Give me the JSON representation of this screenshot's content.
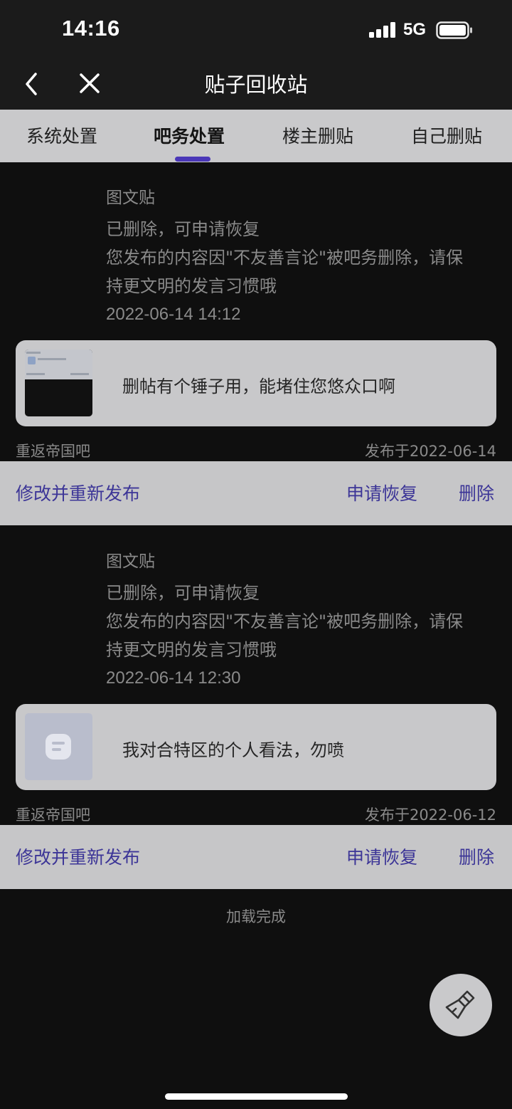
{
  "status_bar": {
    "time": "14:16",
    "network": "5G"
  },
  "header": {
    "title": "贴子回收站",
    "back_icon": "chevron-left-icon",
    "close_icon": "close-icon"
  },
  "tabs": [
    {
      "label": "系统处置",
      "active": false
    },
    {
      "label": "吧务处置",
      "active": true
    },
    {
      "label": "楼主删贴",
      "active": false
    },
    {
      "label": "自己删贴",
      "active": false
    }
  ],
  "accent_color": "#4a37b8",
  "posts": [
    {
      "type": "图文贴",
      "status": "已删除，可申请恢复",
      "reason": "您发布的内容因\"不友善言论\"被吧务删除，请保持更文明的发言习惯哦",
      "time": "2022-06-14 14:12",
      "preview_text": "删帖有个锤子用，能堵住您悠众口啊",
      "thumbnail": "screenshot-thumbnail",
      "forum": "重返帝国吧",
      "published": "发布于2022-06-14",
      "actions": {
        "edit": "修改并重新发布",
        "restore": "申请恢复",
        "delete": "删除"
      }
    },
    {
      "type": "图文贴",
      "status": "已删除，可申请恢复",
      "reason": "您发布的内容因\"不友善言论\"被吧务删除，请保持更文明的发言习惯哦",
      "time": "2022-06-14 12:30",
      "preview_text": "我对合特区的个人看法，勿喷",
      "thumbnail": "document-icon",
      "forum": "重返帝国吧",
      "published": "发布于2022-06-12",
      "actions": {
        "edit": "修改并重新发布",
        "restore": "申请恢复",
        "delete": "删除"
      }
    }
  ],
  "footer": {
    "load_status": "加载完成"
  },
  "fab": {
    "icon": "broom-icon"
  }
}
